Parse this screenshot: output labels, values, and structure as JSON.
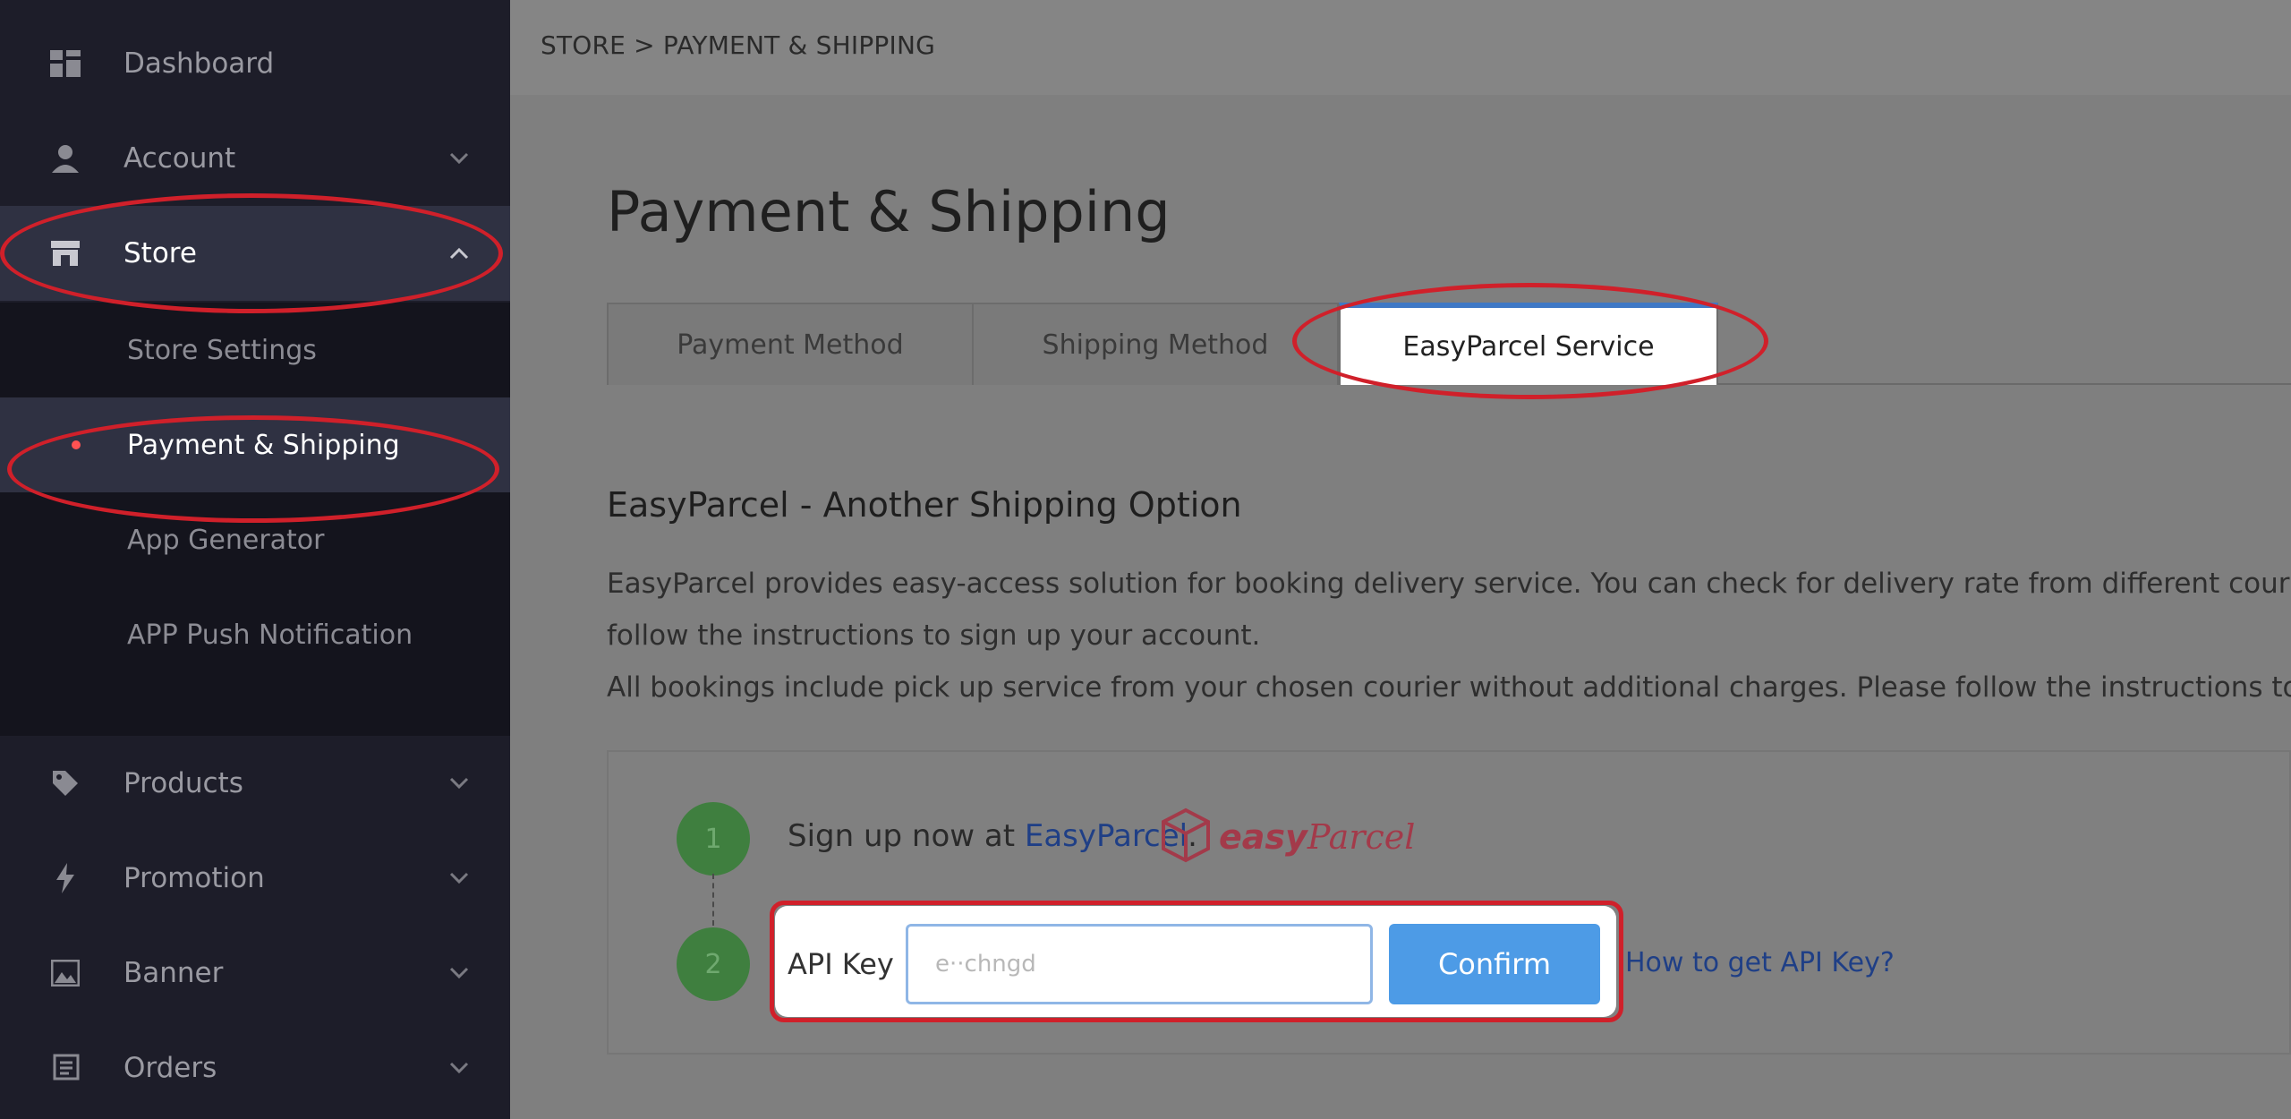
{
  "sidebar": {
    "items": [
      {
        "label": "Dashboard",
        "icon": "dashboard-icon"
      },
      {
        "label": "Account",
        "icon": "user-icon"
      },
      {
        "label": "Store",
        "icon": "store-icon"
      },
      {
        "label": "Products",
        "icon": "tag-icon"
      },
      {
        "label": "Promotion",
        "icon": "bolt-icon"
      },
      {
        "label": "Banner",
        "icon": "image-icon"
      },
      {
        "label": "Orders",
        "icon": "orders-icon"
      }
    ],
    "store_submenu": [
      {
        "label": "Store Settings"
      },
      {
        "label": "Payment & Shipping"
      },
      {
        "label": "App Generator"
      },
      {
        "label": "APP Push Notification"
      }
    ]
  },
  "header": {
    "breadcrumb": "STORE > PAYMENT & SHIPPING"
  },
  "main": {
    "title": "Payment & Shipping",
    "tabs": [
      {
        "label": "Payment Method"
      },
      {
        "label": "Shipping Method"
      },
      {
        "label": "EasyParcel Service"
      }
    ],
    "section_title": "EasyParcel - Another Shipping Option",
    "description": [
      "EasyParcel provides easy-access solution for booking delivery service. You can check for delivery rate from different courier",
      "follow the instructions to sign up your account.",
      "All bookings include pick up service from your chosen courier without additional charges. Please follow the instructions to a"
    ],
    "steps": {
      "step1_number": "1",
      "step2_number": "2",
      "signup_prefix": "Sign up now at ",
      "signup_link": "EasyParcel",
      "signup_suffix": ".",
      "logo_text_bold": "easy",
      "logo_text_script": "Parcel",
      "api_label": "API Key",
      "api_value": "e··chngd",
      "confirm_label": "Confirm",
      "help_link": "How to get API Key?"
    }
  },
  "colors": {
    "sidebar_bg": "#1d1d29",
    "active_bg": "#2f3142",
    "accent_blue": "#4d9be6",
    "annotation_red": "#d0202a",
    "step_green": "#3f7f3f"
  }
}
